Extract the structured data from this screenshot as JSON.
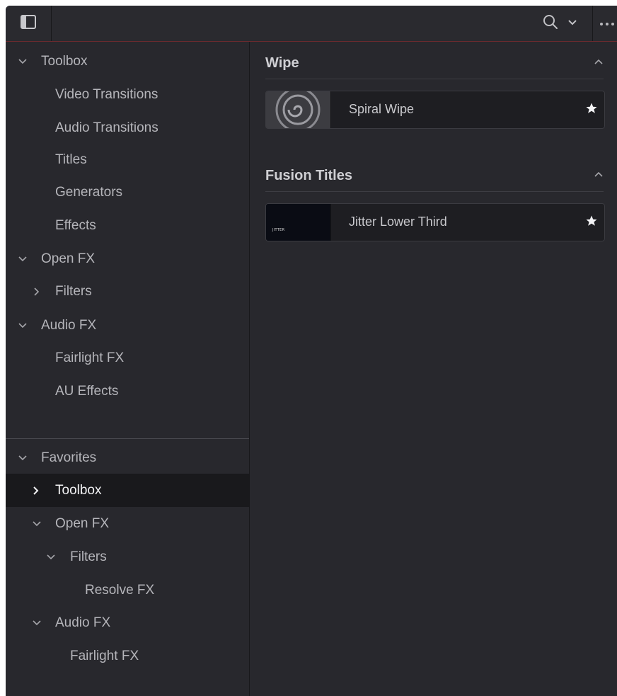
{
  "tree": {
    "top": [
      {
        "label": "Toolbox",
        "chevron": "chevron-down"
      },
      {
        "label": "Video Transitions"
      },
      {
        "label": "Audio Transitions"
      },
      {
        "label": "Titles"
      },
      {
        "label": "Generators"
      },
      {
        "label": "Effects"
      },
      {
        "label": "Open FX",
        "chevron": "chevron-down"
      },
      {
        "label": "Filters",
        "chevron": "chevron-right"
      },
      {
        "label": "Audio FX",
        "chevron": "chevron-down"
      },
      {
        "label": "Fairlight FX"
      },
      {
        "label": "AU Effects"
      }
    ],
    "favorites": [
      {
        "label": "Favorites",
        "chevron": "chevron-down"
      },
      {
        "label": "Toolbox",
        "chevron": "chevron-right",
        "selected": true
      },
      {
        "label": "Open FX",
        "chevron": "chevron-down"
      },
      {
        "label": "Filters",
        "chevron": "chevron-down"
      },
      {
        "label": "Resolve FX"
      },
      {
        "label": "Audio FX",
        "chevron": "chevron-down"
      },
      {
        "label": "Fairlight FX"
      }
    ]
  },
  "sections": [
    {
      "title": "Wipe",
      "items": [
        {
          "label": "Spiral Wipe",
          "thumb": "spiral-thumbnail",
          "favorite": true
        }
      ]
    },
    {
      "title": "Fusion Titles",
      "items": [
        {
          "label": "Jitter Lower Third",
          "thumb": "jitter-thumbnail",
          "thumb_text": "JITTER",
          "favorite": true
        }
      ]
    }
  ],
  "icons": {
    "sidebar_toggle": "sidebar-toggle-icon",
    "search": "search-icon",
    "dropdown": "chevron-down-icon",
    "more": "more-options-icon"
  },
  "colors": {
    "background": "#28282d",
    "selected_row": "#19191c",
    "accent_line": "#6b2a2e"
  }
}
